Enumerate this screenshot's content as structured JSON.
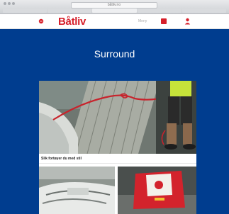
{
  "browser": {
    "address": "båtliv.no"
  },
  "header": {
    "logo": "Båtliv",
    "link_label": "Meny"
  },
  "main": {
    "section_title": "Surround",
    "featured": {
      "caption": "Slik fortøyer du med stil"
    }
  },
  "colors": {
    "brand_red": "#d61f2a",
    "page_blue": "#003d8f"
  }
}
